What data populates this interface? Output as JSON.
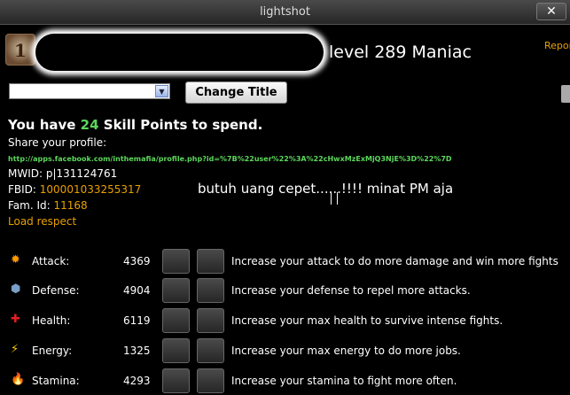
{
  "window": {
    "title": "lightshot",
    "close_glyph": "✕"
  },
  "profile": {
    "emblem_glyph": "1",
    "level_text": "level 289 Maniac",
    "report_label": "Repor"
  },
  "title_form": {
    "select_value": "",
    "change_title_label": "Change Title"
  },
  "skill_points": {
    "prefix": "You have ",
    "count": "24",
    "suffix": " Skill Points to spend."
  },
  "share": {
    "label": "Share your profile:",
    "url": "http://apps.facebook.com/inthemafia/profile.php?id=%7B%22user%22%3A%22cHwxMzExMjQ3NjE%3D%22%7D"
  },
  "ids": {
    "mwid_label": "MWID: ",
    "mwid_value": "p|131124761",
    "fbid_label": "FBID: ",
    "fbid_value": "100001033255317",
    "fam_label": "Fam. Id: ",
    "fam_value": "11168",
    "load_respect": "Load respect"
  },
  "overlay_message": "butuh uang cepet......!!!! minat PM aja",
  "stats": [
    {
      "icon": "attack-icon",
      "glyph": "✹",
      "color": "#ff9900",
      "name": "Attack:",
      "value": "4369",
      "desc": "Increase your attack to do more damage and win more fights"
    },
    {
      "icon": "defense-icon",
      "glyph": "⬢",
      "color": "#7aa0c8",
      "name": "Defense:",
      "value": "4904",
      "desc": "Increase your defense to repel more attacks."
    },
    {
      "icon": "health-icon",
      "glyph": "✚",
      "color": "#e02020",
      "name": "Health:",
      "value": "6119",
      "desc": "Increase your max health to survive intense fights."
    },
    {
      "icon": "energy-icon",
      "glyph": "⚡",
      "color": "#ffcc00",
      "name": "Energy:",
      "value": "1325",
      "desc": "Increase your max energy to do more jobs."
    },
    {
      "icon": "stamina-icon",
      "glyph": "🔥",
      "color": "#ff6a00",
      "name": "Stamina:",
      "value": "4293",
      "desc": "Increase your stamina to fight more often."
    }
  ]
}
